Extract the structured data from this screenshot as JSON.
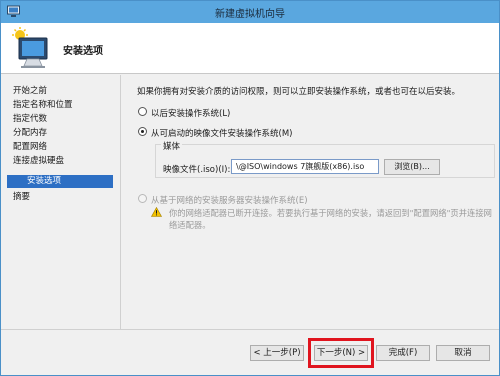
{
  "window": {
    "title": "新建虚拟机向导"
  },
  "header": {
    "title": "安装选项"
  },
  "nav": {
    "items": [
      {
        "label": "开始之前",
        "active": false
      },
      {
        "label": "指定名称和位置",
        "active": false
      },
      {
        "label": "指定代数",
        "active": false
      },
      {
        "label": "分配内存",
        "active": false
      },
      {
        "label": "配置网络",
        "active": false
      },
      {
        "label": "连接虚拟硬盘",
        "active": false
      },
      {
        "label": "安装选项",
        "active": true
      },
      {
        "label": "摘要",
        "active": false
      }
    ]
  },
  "content": {
    "description": "如果你拥有对安装介质的访问权限，则可以立即安装操作系统，或者也可在以后安装。",
    "option_later": "以后安装操作系统(L)",
    "option_bootable": "从可启动的映像文件安装操作系统(M)",
    "media": {
      "legend": "媒体",
      "file_label": "映像文件(.iso)(I):",
      "file_value": "\\@ISO\\windows 7旗舰版(x86).iso",
      "browse_label": "浏览(B)..."
    },
    "option_network": "从基于网络的安装服务器安装操作系统(E)",
    "warning": "你的网络适配器已断开连接。若要执行基于网络的安装，请返回到\"配置网络\"页并连接网络适配器。"
  },
  "footer": {
    "prev_label": "< 上一步(P)",
    "next_label": "下一步(N) >",
    "finish_label": "完成(F)",
    "cancel_label": "取消"
  },
  "colors": {
    "titlebar": "#5aa7df",
    "nav_active": "#2d6fc4",
    "highlight": "#e0141e"
  }
}
